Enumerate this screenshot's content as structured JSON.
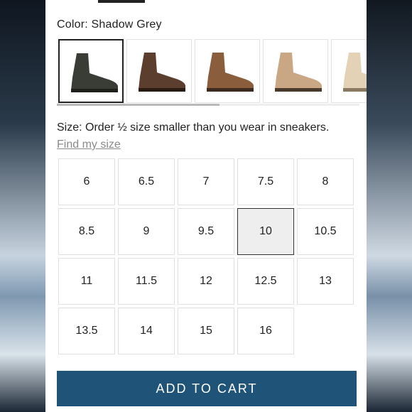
{
  "color": {
    "label": "Color: Shadow Grey",
    "swatches": [
      {
        "name": "Shadow Grey",
        "hex": "#3a3d36",
        "selected": true
      },
      {
        "name": "Brown",
        "hex": "#5b3e2d",
        "selected": false
      },
      {
        "name": "Tan",
        "hex": "#8a5e3c",
        "selected": false
      },
      {
        "name": "Sand",
        "hex": "#c9a785",
        "selected": false
      },
      {
        "name": "Cream",
        "hex": "#e3d2b5",
        "selected": false
      }
    ]
  },
  "size": {
    "label": "Size: Order ½ size smaller than you wear in sneakers.",
    "find_link": "Find my size",
    "options": [
      "6",
      "6.5",
      "7",
      "7.5",
      "8",
      "8.5",
      "9",
      "9.5",
      "10",
      "10.5",
      "11",
      "11.5",
      "12",
      "12.5",
      "13",
      "13.5",
      "14",
      "15",
      "16"
    ],
    "selected": "10"
  },
  "cart": {
    "label": "ADD TO CART",
    "color": "#1f5378"
  }
}
